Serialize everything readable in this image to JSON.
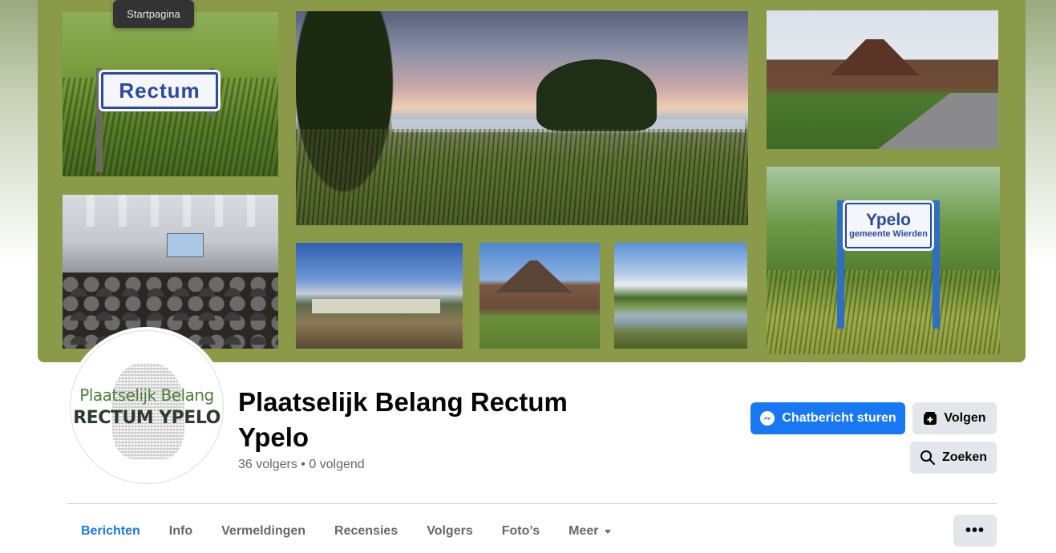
{
  "tooltip": "Startpagina",
  "cover": {
    "signs": {
      "rectum": "Rectum",
      "ypelo": "Ypelo",
      "ypelo_sub": "gemeente Wierden"
    }
  },
  "avatar": {
    "line1": "Plaatselijk Belang",
    "line2": "RECTUM YPELO"
  },
  "page": {
    "title": "Plaatselijk Belang Rectum Ypelo",
    "followers": "36 volgers • 0 volgend"
  },
  "actions": {
    "message": "Chatbericht sturen",
    "follow": "Volgen",
    "search": "Zoeken",
    "more": "•••"
  },
  "icons": {
    "message": "messenger-icon",
    "follow": "follow-icon",
    "search": "search-icon",
    "dropdown": "caret-down-icon"
  },
  "tabs": [
    {
      "label": "Berichten",
      "active": true
    },
    {
      "label": "Info"
    },
    {
      "label": "Vermeldingen"
    },
    {
      "label": "Recensies"
    },
    {
      "label": "Volgers"
    },
    {
      "label": "Foto’s"
    },
    {
      "label": "Meer"
    }
  ],
  "colors": {
    "accent": "#1877f2",
    "cover_frame": "#8a9a48",
    "secondary_button": "#e4e6eb"
  }
}
